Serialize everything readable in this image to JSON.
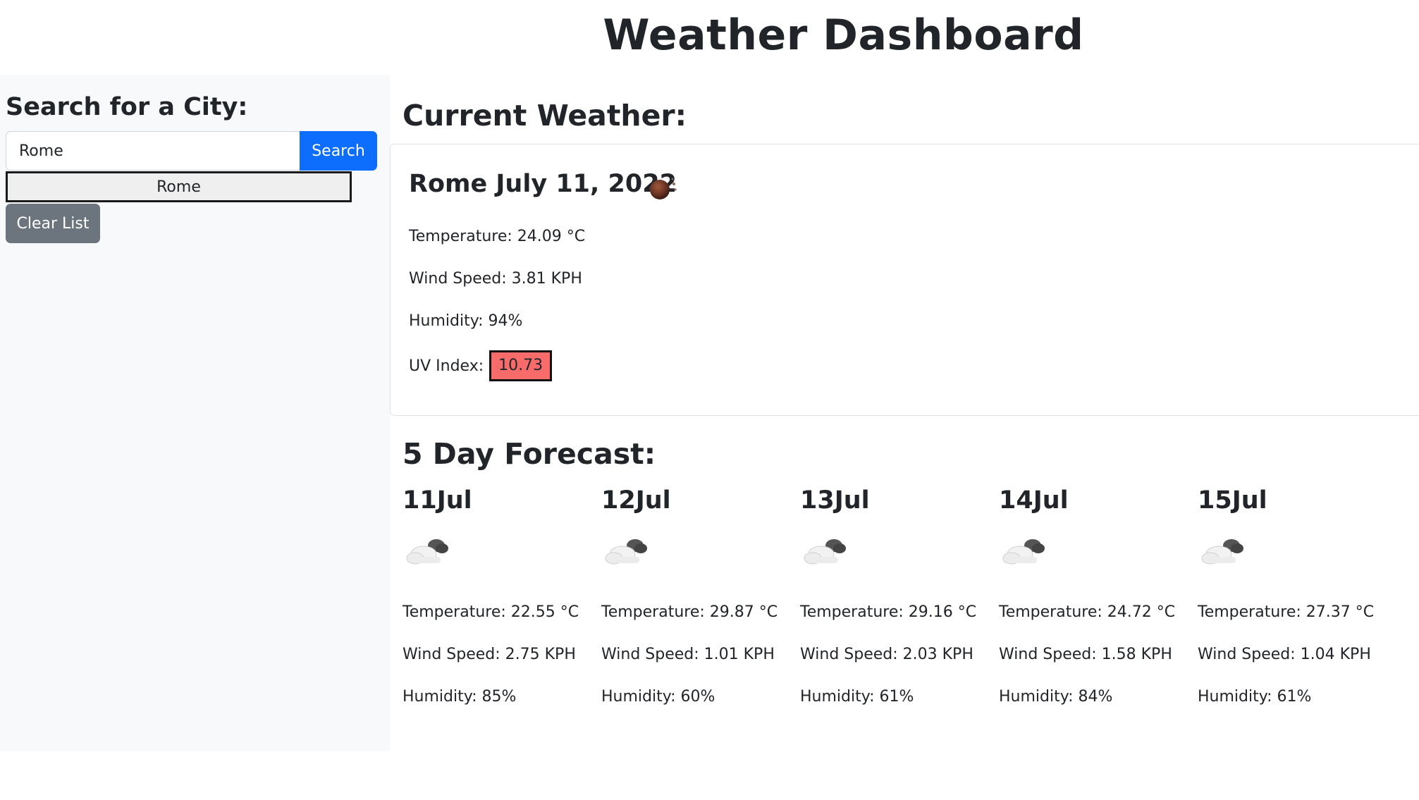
{
  "header": {
    "title": "Weather Dashboard"
  },
  "sidebar": {
    "heading": "Search for a City:",
    "search_value": "Rome",
    "search_button": "Search",
    "history": [
      "Rome"
    ],
    "clear_button": "Clear List"
  },
  "current": {
    "heading": "Current Weather:",
    "title": "Rome July 11, 2022",
    "icon": "sun-haze-icon",
    "temperature": "Temperature: 24.09 °C",
    "wind": "Wind Speed: 3.81 KPH",
    "humidity": "Humidity: 94%",
    "uv_label": "UV Index:",
    "uv_value": "10.73",
    "uv_color": "#f76b6b"
  },
  "forecast": {
    "heading": "5 Day Forecast:",
    "days": [
      {
        "date": "11Jul",
        "icon": "cloudy-icon",
        "temperature": "Temperature: 22.55 °C",
        "wind": "Wind Speed: 2.75 KPH",
        "humidity": "Humidity: 85%"
      },
      {
        "date": "12Jul",
        "icon": "cloudy-icon",
        "temperature": "Temperature: 29.87 °C",
        "wind": "Wind Speed: 1.01 KPH",
        "humidity": "Humidity: 60%"
      },
      {
        "date": "13Jul",
        "icon": "cloudy-icon",
        "temperature": "Temperature: 29.16 °C",
        "wind": "Wind Speed: 2.03 KPH",
        "humidity": "Humidity: 61%"
      },
      {
        "date": "14Jul",
        "icon": "cloudy-icon",
        "temperature": "Temperature: 24.72 °C",
        "wind": "Wind Speed: 1.58 KPH",
        "humidity": "Humidity: 84%"
      },
      {
        "date": "15Jul",
        "icon": "cloudy-icon",
        "temperature": "Temperature: 27.37 °C",
        "wind": "Wind Speed: 1.04 KPH",
        "humidity": "Humidity: 61%"
      }
    ]
  },
  "colors": {
    "primary": "#0d6efd",
    "secondary": "#6c757d",
    "sidebar_bg": "#f8f9fa"
  }
}
